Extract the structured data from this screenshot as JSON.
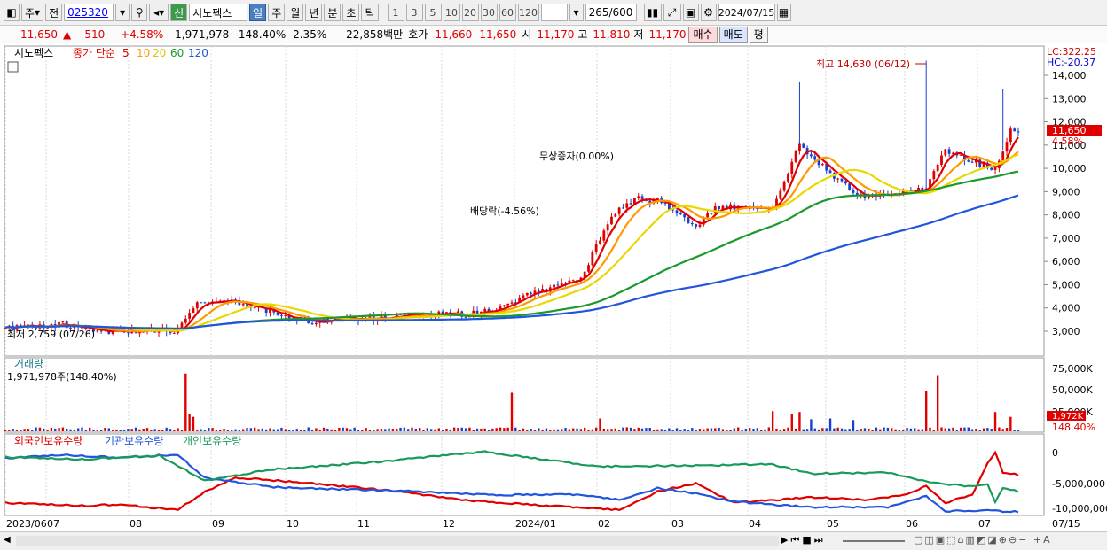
{
  "toolbar": {
    "period_unit": "주",
    "prev_label": "전",
    "stock_code": "025320",
    "stock_name_badge": "신",
    "stock_name": "시노펙스",
    "timeframes": [
      "일",
      "주",
      "월",
      "년",
      "분",
      "초",
      "틱"
    ],
    "active_timeframe": "일",
    "intervals": [
      "1",
      "3",
      "5",
      "10",
      "20",
      "30",
      "60",
      "120"
    ],
    "display_count": "265",
    "display_total": "/600",
    "date": "2024/07/15"
  },
  "quote": {
    "price": "11,650",
    "arrow": "▲",
    "change": "510",
    "change_pct": "+4.58%",
    "volume": "1,971,978",
    "volume_ratio": "148.40%",
    "turnover": "2.35%",
    "amount": "22,858백만",
    "bid_label": "호가",
    "bid": "11,660",
    "ask": "11,650",
    "open_label": "시",
    "open": "11,170",
    "high_label": "고",
    "high": "11,810",
    "low_label": "저",
    "low": "11,170",
    "buy_button": "매수",
    "sell_button": "매도",
    "avg_button": "평"
  },
  "price_panel": {
    "stock_label": "시노펙스",
    "ma_label": "종가 단순",
    "ma_periods": [
      "5",
      "10",
      "20",
      "60",
      "120"
    ],
    "ma_colors": [
      "#e00000",
      "#ff9900",
      "#e8d800",
      "#1a9a2a",
      "#2255dd"
    ],
    "lc": "LC:322.25",
    "hc": "HC:-20.37",
    "current_price": "11,650",
    "current_pct": "4.58%",
    "annot_high": "최고 14,630 (06/12)",
    "annot_low": "최저 2,759 (07/26)",
    "annot_dividend": "배당락(-4.56%)",
    "annot_bonus": "무상증자(0.00%)",
    "y_ticks": [
      "14,000",
      "13,000",
      "12,000",
      "11,000",
      "10,000",
      "9,000",
      "8,000",
      "7,000",
      "6,000",
      "5,000",
      "4,000",
      "3,000"
    ]
  },
  "volume_panel": {
    "title": "거래량",
    "value": "1,971,978주(148.40%)",
    "y_ticks": [
      "75,000K",
      "50,000K",
      "25,000K"
    ],
    "current": "1,972K",
    "current_pct": "148.40%"
  },
  "holdings_panel": {
    "legend": [
      "외국인보유수량",
      "기관보유수량",
      "개인보유수량"
    ],
    "colors": [
      "#e00000",
      "#2255dd",
      "#1a9a5a"
    ],
    "y_ticks": [
      "0",
      "-5,000,000",
      "-10,000,000"
    ]
  },
  "x_axis": {
    "labels": [
      "2023/06",
      "07",
      "08",
      "09",
      "10",
      "11",
      "12",
      "2024/01",
      "02",
      "03",
      "04",
      "05",
      "06",
      "07"
    ],
    "right_label": "07/15"
  }
}
